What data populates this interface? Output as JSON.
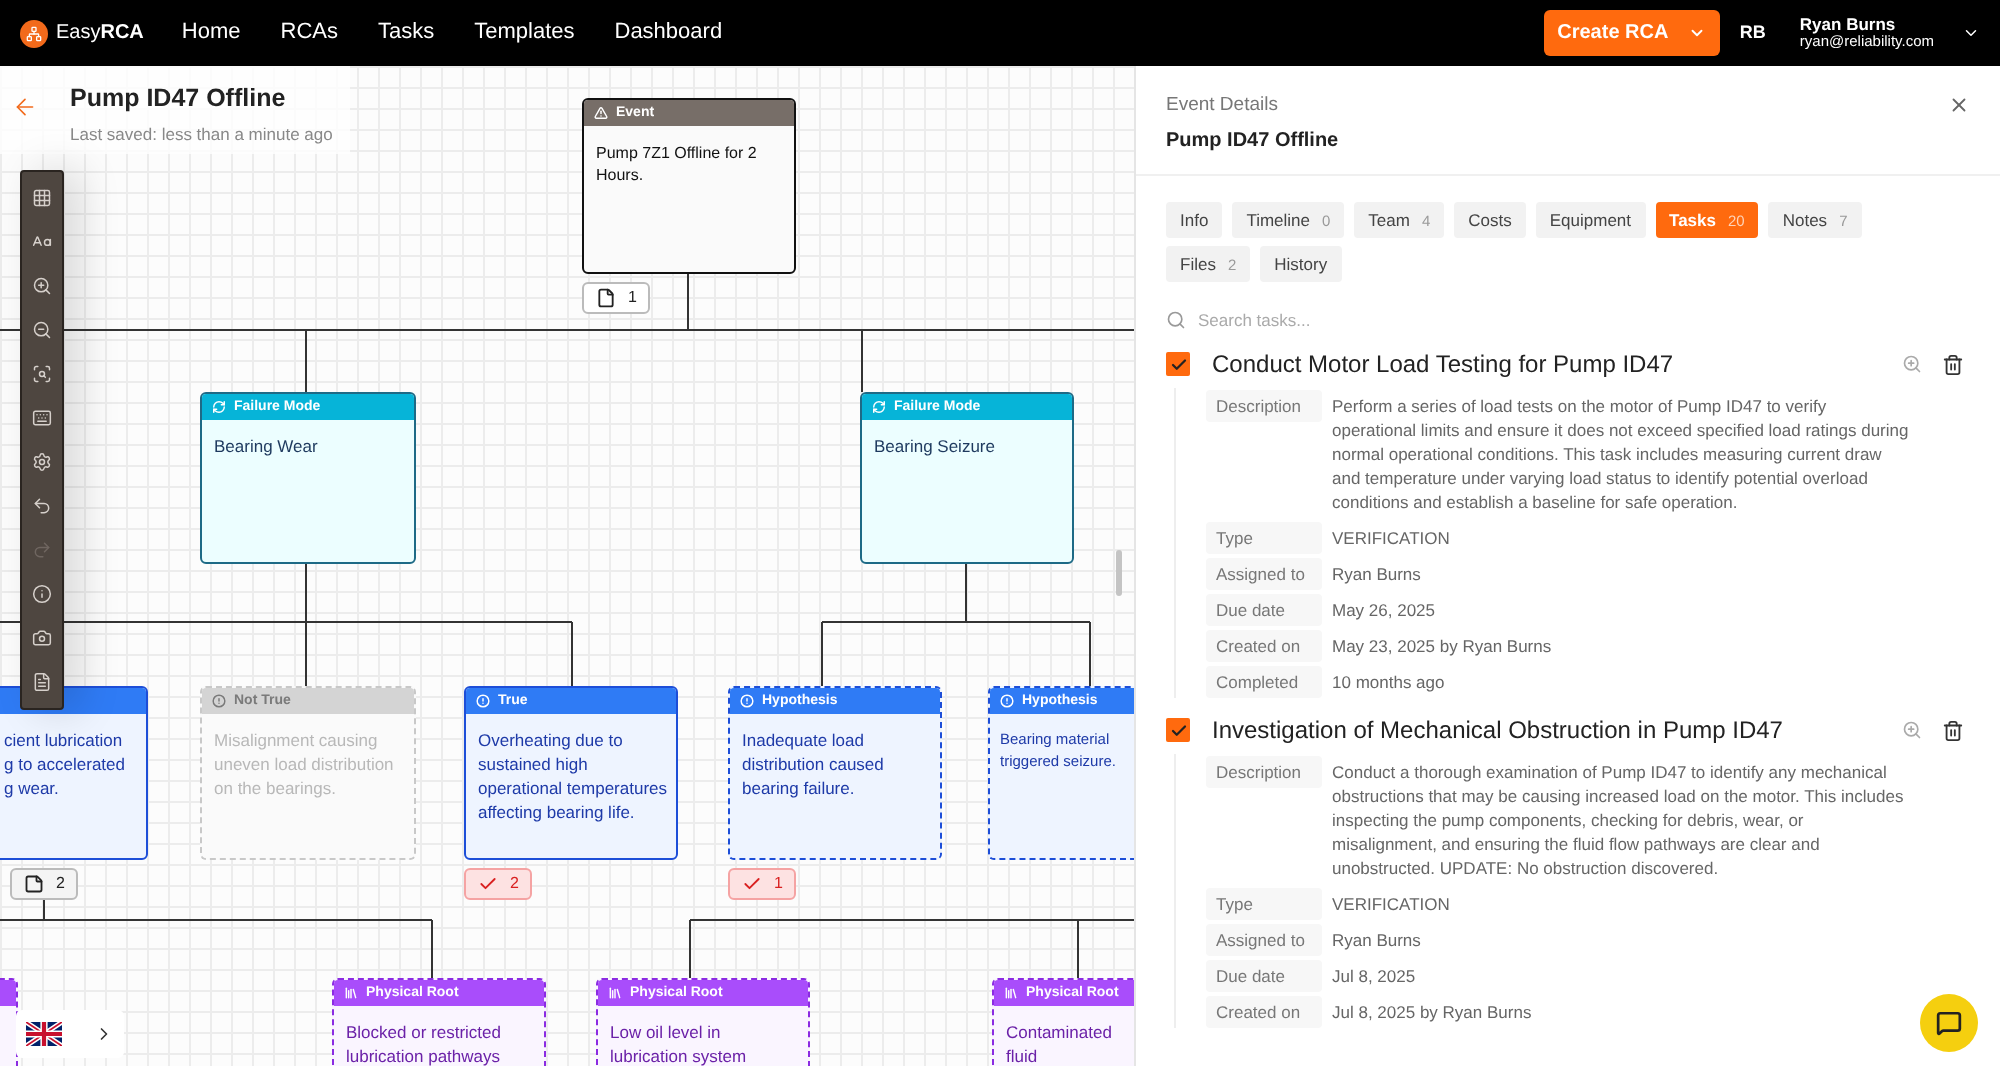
{
  "app": {
    "logo_prefix": "Easy",
    "logo_bold": "RCA"
  },
  "nav": [
    {
      "label": "Home",
      "selected": false
    },
    {
      "label": "RCAs",
      "selected": false
    },
    {
      "label": "Tasks",
      "selected": false
    },
    {
      "label": "Templates",
      "selected": false
    },
    {
      "label": "Dashboard",
      "selected": false
    }
  ],
  "create_button": "Create RCA",
  "user": {
    "initials": "RB",
    "name": "Ryan Burns",
    "email": "ryan@reliability.com"
  },
  "canvas": {
    "title": "Pump ID47 Offline",
    "subtitle": "Last saved: less than a minute ago",
    "toolbar": [
      {
        "kind": "grid",
        "disabled": false
      },
      {
        "kind": "text",
        "disabled": false
      },
      {
        "kind": "zoom_in",
        "disabled": false
      },
      {
        "kind": "zoom_out",
        "disabled": false
      },
      {
        "kind": "fit",
        "disabled": false
      },
      {
        "kind": "keyboard",
        "disabled": false
      },
      {
        "kind": "settings",
        "disabled": false
      },
      {
        "kind": "undo",
        "disabled": false
      },
      {
        "kind": "redo",
        "disabled": true
      },
      {
        "kind": "info",
        "disabled": false
      },
      {
        "kind": "camera",
        "disabled": false
      },
      {
        "kind": "export",
        "disabled": false
      }
    ],
    "nodes": [
      {
        "kind": "event",
        "label": "Event",
        "text": "Pump 7Z1 Offline for 2 Hours.",
        "badge": {
          "kind": "file",
          "count": "1"
        }
      },
      {
        "kind": "failure_mode",
        "label": "Failure Mode",
        "text": "Bearing Wear"
      },
      {
        "kind": "failure_mode",
        "label": "Failure Mode",
        "text": "Bearing Seizure"
      },
      {
        "kind": "true",
        "text": "cient lubrication\ng to accelerated\ng wear.",
        "badge": {
          "kind": "note",
          "count": "2"
        }
      },
      {
        "kind": "not_true",
        "label": "Not True",
        "text": "Misalignment causing uneven load distribution on the bearings."
      },
      {
        "kind": "true",
        "label": "True",
        "text": "Overheating due to sustained high operational temperatures affecting bearing life.",
        "badge": {
          "kind": "verified",
          "count": "2"
        }
      },
      {
        "kind": "hypothesis",
        "label": "Hypothesis",
        "text": "Inadequate load distribution caused bearing failure.",
        "badge": {
          "kind": "verified",
          "count": "1"
        }
      },
      {
        "kind": "hypothesis",
        "label": "Hypothesis",
        "text": "Bearing material\ntriggered seizure."
      },
      {
        "kind": "physical_root"
      },
      {
        "kind": "physical_root",
        "label": "Physical Root",
        "text": "Blocked or restricted lubrication pathways"
      },
      {
        "kind": "physical_root",
        "label": "Physical Root",
        "text": "Low oil level in lubrication system"
      },
      {
        "kind": "physical_root",
        "label": "Physical Root",
        "text": "Contaminated\nfluid"
      }
    ]
  },
  "panel": {
    "heading": "Event Details",
    "title": "Pump ID47 Offline",
    "tabs": [
      {
        "label": "Info",
        "selected": false
      },
      {
        "label": "Timeline",
        "count": "0",
        "selected": false
      },
      {
        "label": "Team",
        "count": "4",
        "selected": false
      },
      {
        "label": "Costs",
        "selected": false
      },
      {
        "label": "Equipment",
        "selected": false
      },
      {
        "label": "Tasks",
        "count": "20",
        "selected": true
      },
      {
        "label": "Notes",
        "count": "7",
        "selected": false
      },
      {
        "label": "Files",
        "count": "2",
        "selected": false
      },
      {
        "label": "History",
        "selected": false
      }
    ],
    "search": {
      "placeholder": "Search tasks..."
    },
    "tasks": [
      {
        "checked": true,
        "title": "Conduct Motor Load Testing for Pump ID47",
        "fields": [
          {
            "label": "Description",
            "value": "Perform a series of load tests on the motor of Pump ID47 to verify operational limits and ensure it does not exceed specified load ratings during normal operational conditions. This task includes measuring current draw and temperature under varying load status to identify potential overload conditions and establish a baseline for safe operation."
          },
          {
            "label": "Type",
            "value": "VERIFICATION"
          },
          {
            "label": "Assigned to",
            "value": "Ryan Burns"
          },
          {
            "label": "Due date",
            "value": "May 26, 2025"
          },
          {
            "label": "Created on",
            "value": "May 23, 2025 by Ryan Burns"
          },
          {
            "label": "Completed",
            "value": "10 months ago"
          }
        ]
      },
      {
        "checked": true,
        "title": "Investigation of Mechanical Obstruction in Pump ID47",
        "fields": [
          {
            "label": "Description",
            "value": "Conduct a thorough examination of Pump ID47 to identify any mechanical obstructions that may be causing increased load on the motor. This includes inspecting the pump components, checking for debris, wear, or misalignment, and ensuring the fluid flow pathways are clear and unobstructed. UPDATE: No obstruction discovered."
          },
          {
            "label": "Type",
            "value": "VERIFICATION"
          },
          {
            "label": "Assigned to",
            "value": "Ryan Burns"
          },
          {
            "label": "Due date",
            "value": "Jul 8, 2025"
          },
          {
            "label": "Created on",
            "value": "Jul 8, 2025 by Ryan Burns"
          }
        ]
      }
    ]
  }
}
